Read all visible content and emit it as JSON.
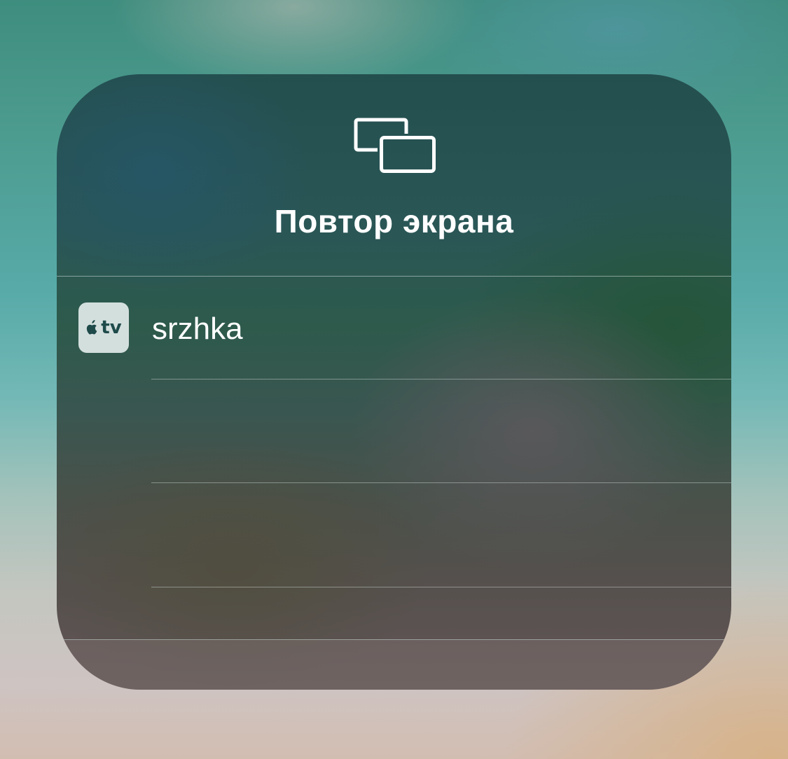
{
  "panel": {
    "title": "Повтор экрана",
    "icon": "screen-mirroring-icon"
  },
  "devices": [
    {
      "name": "srzhka",
      "icon": "apple-tv-icon",
      "icon_label": "tv"
    }
  ],
  "colors": {
    "text": "#ffffff",
    "apple_tv_badge_bg": "#d3dfdd",
    "apple_tv_badge_fg": "#1e4a4a"
  }
}
